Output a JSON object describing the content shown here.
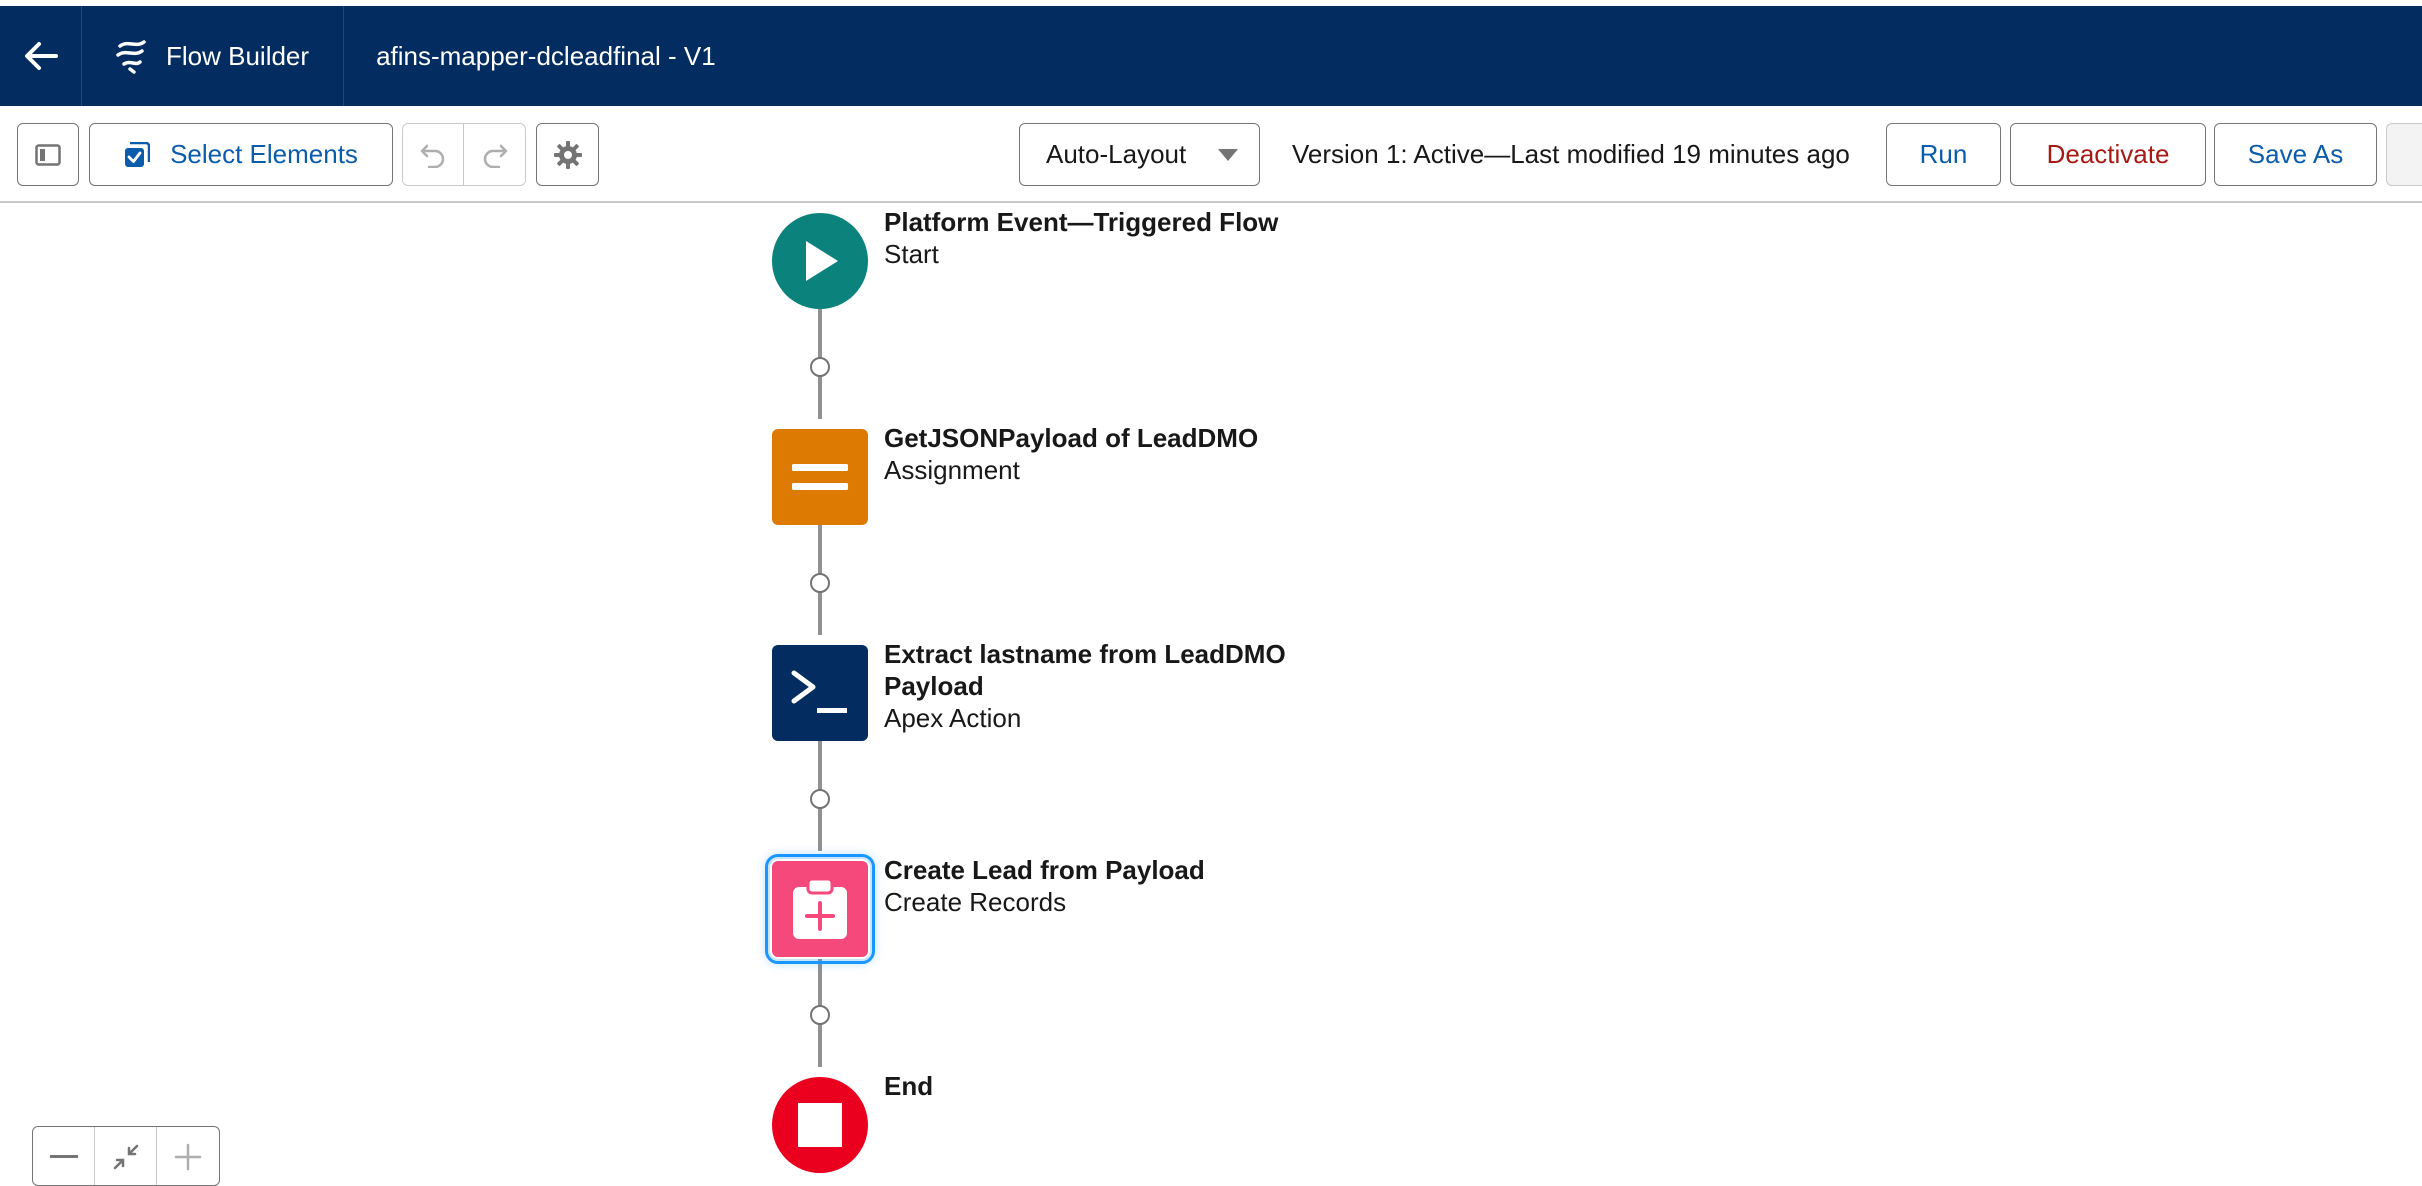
{
  "header": {
    "back_icon": "arrow-left-icon",
    "app_icon": "flow-builder-logo-icon",
    "app_name": "Flow Builder",
    "flow_title": "afins-mapper-dcleadfinal - V1",
    "background_color": "#032d60"
  },
  "toolbar": {
    "toggle_panel_icon": "panel-toggle-icon",
    "select_elements_label": "Select Elements",
    "select_elements_icon": "multi-select-icon",
    "undo_icon": "undo-icon",
    "redo_icon": "redo-icon",
    "settings_icon": "gear-icon",
    "layout_select_value": "Auto-Layout",
    "layout_dropdown_icon": "caret-down-icon",
    "status_text": "Version 1: Active—Last modified 19 minutes ago",
    "run_label": "Run",
    "deactivate_label": "Deactivate",
    "save_as_label": "Save As",
    "accent_color": "#0b5cab",
    "danger_color": "#a61a14"
  },
  "flow": {
    "nodes": [
      {
        "label": "Platform Event—Triggered Flow",
        "type": "Start",
        "icon": "play-icon",
        "color": "#0b827c"
      },
      {
        "label": "GetJSONPayload of LeadDMO",
        "type": "Assignment",
        "icon": "equals-icon",
        "color": "#dd7a01"
      },
      {
        "label": "Extract lastname from LeadDMO Payload",
        "type": "Apex Action",
        "icon": "apex-console-icon",
        "color": "#032d60"
      },
      {
        "label": "Create Lead from Payload",
        "type": "Create Records",
        "icon": "clipboard-add-icon",
        "color": "#f4497a",
        "selected": true
      },
      {
        "label": "End",
        "type": "",
        "icon": "stop-icon",
        "color": "#ea001e"
      }
    ]
  },
  "zoom": {
    "zoom_out_icon": "minus-icon",
    "fit_icon": "fit-to-screen-icon",
    "zoom_in_icon": "plus-icon"
  }
}
